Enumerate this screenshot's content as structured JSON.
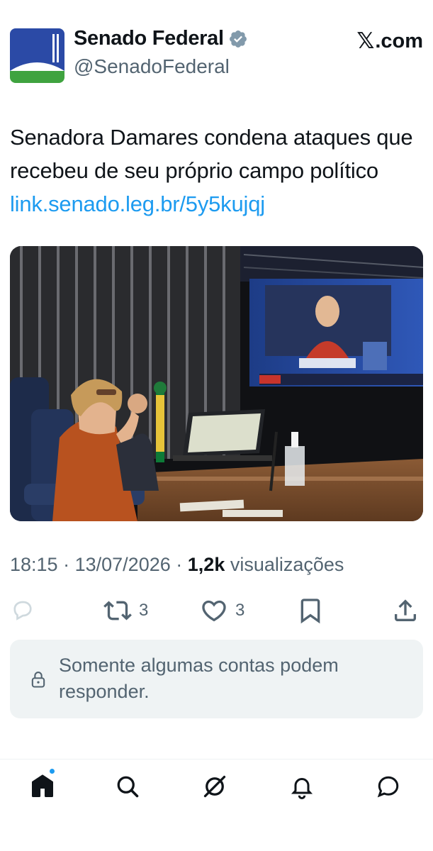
{
  "account": {
    "display_name": "Senado Federal",
    "handle": "@SenadoFederal",
    "verified": true,
    "avatar_icon": "senado-federal-logo"
  },
  "brand": {
    "source": ".com",
    "x_glyph": "𝕏"
  },
  "tweet": {
    "text": "Senadora Damares condena ataques que recebeu de seu próprio campo político",
    "link": "link.senado.leg.br/5y5kujqj",
    "media_icon": "senate-plenary-photo"
  },
  "meta": {
    "time": "18:15",
    "separator": "·",
    "date": "13/07/2026",
    "views_count": "1,2k",
    "views_label": "visualizações"
  },
  "actions": {
    "reply_icon": "reply-icon",
    "retweet_icon": "retweet-icon",
    "retweet_count": "3",
    "like_icon": "heart-icon",
    "like_count": "3",
    "bookmark_icon": "bookmark-icon",
    "share_icon": "share-icon"
  },
  "reply_notice": {
    "text": "Somente algumas contas podem responder."
  },
  "nav": {
    "items": [
      "home-icon",
      "search-icon",
      "grok-icon",
      "notifications-icon",
      "messages-icon"
    ]
  },
  "colors": {
    "accent": "#1d9bf0",
    "text": "#0f1419",
    "muted": "#536471",
    "panel": "#eff3f4"
  }
}
